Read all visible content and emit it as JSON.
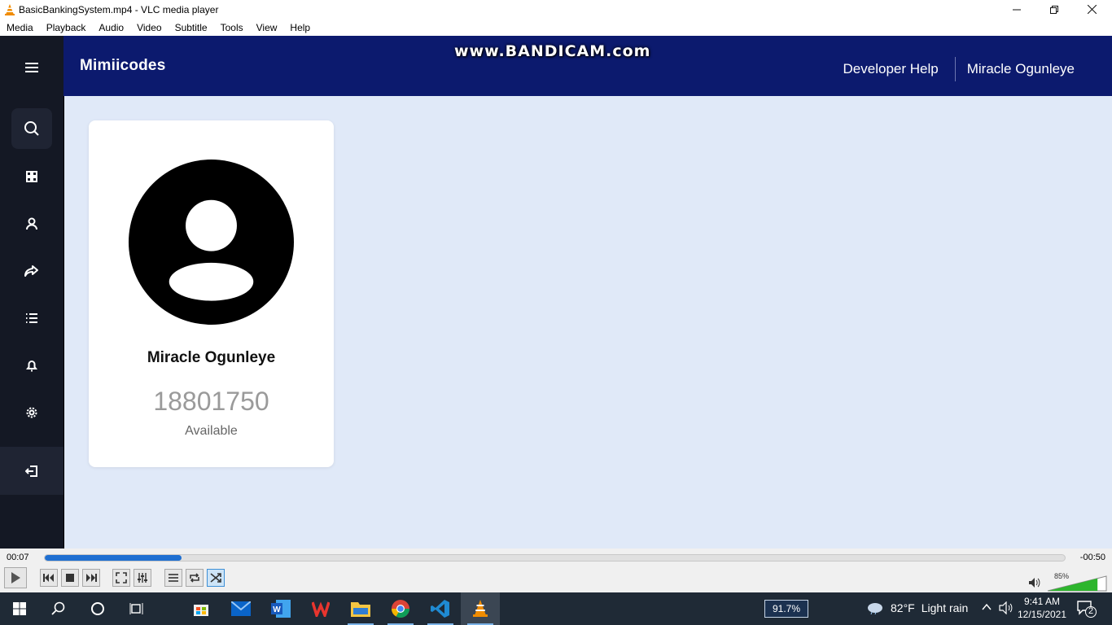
{
  "window": {
    "title": "BasicBankingSystem.mp4 - VLC media player",
    "menu": [
      "Media",
      "Playback",
      "Audio",
      "Video",
      "Subtitle",
      "Tools",
      "View",
      "Help"
    ]
  },
  "app": {
    "brand": "Mimiicodes",
    "watermark": "www.BANDICAM.com",
    "nav": {
      "developer_help": "Developer Help",
      "user_name": "Miracle Ogunleye"
    },
    "sidebar": [
      "menu-icon",
      "search-icon",
      "dashboard-icon",
      "user-icon",
      "share-icon",
      "list-icon",
      "bell-icon",
      "gear-icon",
      "logout-icon"
    ],
    "card": {
      "name": "Miracle Ogunleye",
      "balance": "18801750",
      "status": "Available"
    },
    "colors": {
      "topbar": "#0c1a6e",
      "sidebar": "#141824",
      "content_bg": "#e0e9f8"
    }
  },
  "player": {
    "elapsed": "00:07",
    "remaining": "-00:50",
    "progress_fraction": 0.134,
    "volume": "85%",
    "volume_fraction": 0.85
  },
  "taskbar": {
    "battery": "91.7%",
    "weather_temp": "82°F",
    "weather_desc": "Light rain",
    "time": "9:41 AM",
    "date": "12/15/2021",
    "notifications": "2"
  }
}
